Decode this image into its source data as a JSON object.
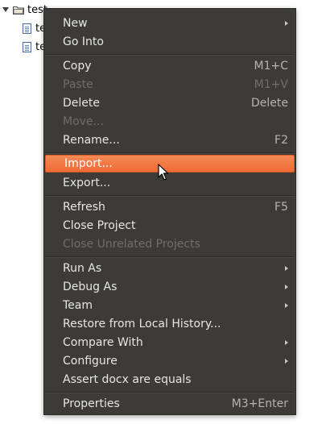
{
  "tree": {
    "root_label": "test",
    "child1_label": "te",
    "child2_label": "te"
  },
  "menu": {
    "new": "New",
    "go_into": "Go Into",
    "copy": "Copy",
    "copy_shortcut": "M1+C",
    "paste": "Paste",
    "paste_shortcut": "M1+V",
    "delete": "Delete",
    "delete_shortcut": "Delete",
    "move": "Move...",
    "rename": "Rename...",
    "rename_shortcut": "F2",
    "import": "Import...",
    "export": "Export...",
    "refresh": "Refresh",
    "refresh_shortcut": "F5",
    "close_project": "Close Project",
    "close_unrelated": "Close Unrelated Projects",
    "run_as": "Run As",
    "debug_as": "Debug As",
    "team": "Team",
    "restore_history": "Restore from Local History...",
    "compare_with": "Compare With",
    "configure": "Configure",
    "assert_docx": "Assert docx are equals",
    "properties": "Properties",
    "properties_shortcut": "M3+Enter"
  },
  "colors": {
    "menu_bg": "#3c3b37",
    "highlight": "#ef6a35",
    "text": "#e6e6e3",
    "disabled_text": "#6f6e68"
  }
}
